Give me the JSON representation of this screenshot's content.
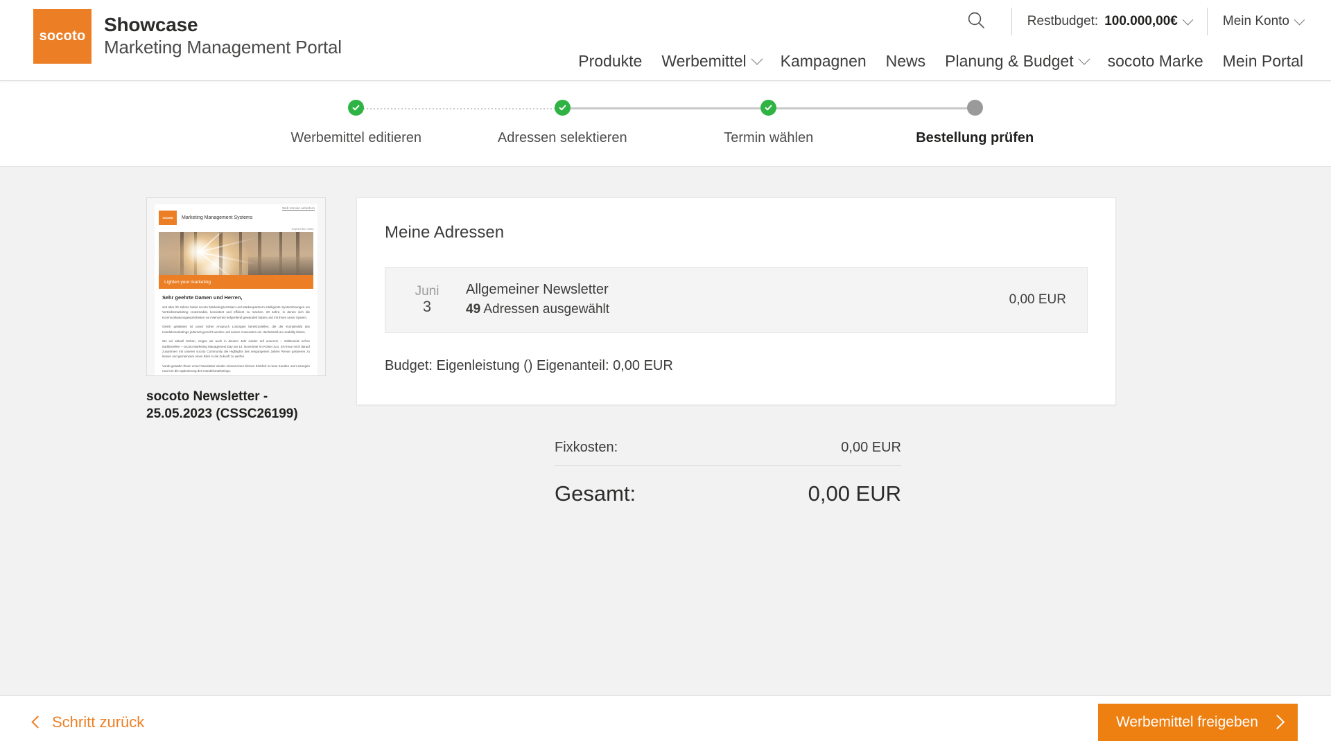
{
  "header": {
    "logo_text": "socoto",
    "title": "Showcase",
    "subtitle": "Marketing Management Portal",
    "search_icon": "search-icon",
    "budget_label": "Restbudget:",
    "budget_value": "100.000,00€",
    "account_label": "Mein Konto",
    "nav": [
      {
        "label": "Produkte",
        "caret": false
      },
      {
        "label": "Werbemittel",
        "caret": true
      },
      {
        "label": "Kampagnen",
        "caret": false
      },
      {
        "label": "News",
        "caret": false
      },
      {
        "label": "Planung & Budget",
        "caret": true
      },
      {
        "label": "socoto Marke",
        "caret": false
      },
      {
        "label": "Mein Portal",
        "caret": false
      }
    ]
  },
  "stepper": {
    "steps": [
      {
        "label": "Werbemittel editieren",
        "state": "done",
        "connector": "dotted"
      },
      {
        "label": "Adressen selektieren",
        "state": "done",
        "connector": "solid"
      },
      {
        "label": "Termin wählen",
        "state": "done",
        "connector": "solid"
      },
      {
        "label": "Bestellung prüfen",
        "state": "current",
        "connector": "none"
      }
    ]
  },
  "preview": {
    "caption": "socoto Newsletter - 25.05.2023 (CSSC26199)",
    "thumbnail": {
      "web_version_link": "Web Version anfordern",
      "logo_text": "socoto",
      "header_title": "Marketing Management Systems",
      "date": "September 2021",
      "hero_caption": "Lighten your marketing",
      "greeting": "Sehr geehrte Damen und Herren,",
      "paragraphs": [
        "seit über 20 Jahren bietet socoto Marketingzentralen und Markenpartnern intelligente Systemlösungen um Vertriebsmarketing crossmedial, konsistent und effizient zu machen. 20 Jahre, in denen sich die Kommunikationsgewohnheiten von Menschen tiefgreifend gewandelt haben und mit ihnen unser System.",
        "Gleich geblieben ist unser hoher Anspruch Lösungen bereitzustellen, die der Komplexität des Handelsmarketings jederzeit gerecht werden und seinen Anwendern ein Höchstmaß an Usability bieten.",
        "Wo wir aktuell stehen, zeigen wir auch in diesem Jahr wieder auf unserem – mittlerweile schon traditionellen – socoto Marketing Management Day am 14. November im Kölner Zoo. Ich freue mich darauf zusammen mit unserer socoto Community die Highlights des vergangenen Jahres Revue passieren zu lassen und gemeinsam einen Blick in die Zukunft zu werfen.",
        "Vorab gewährt Ihnen unser Newsletter wieder einmal einen kleinen Einblick in neue Kunden und Lösungen rund um die Optimierung des Handelsmarketings."
      ]
    }
  },
  "card": {
    "title": "Meine Adressen",
    "address_row": {
      "month": "Juni",
      "day": "3",
      "name": "Allgemeiner Newsletter",
      "count": "49",
      "count_suffix": "Adressen ausgewählt",
      "price": "0,00 EUR"
    },
    "budget_line": "Budget: Eigenleistung () Eigenanteil: 0,00 EUR"
  },
  "totals": {
    "fixed_label": "Fixkosten:",
    "fixed_value": "0,00 EUR",
    "grand_label": "Gesamt:",
    "grand_value": "0,00 EUR"
  },
  "footer": {
    "back_label": "Schritt zurück",
    "primary_label": "Werbemittel freigeben"
  },
  "colors": {
    "brand_orange": "#EC7F26",
    "button_orange": "#EE7F11",
    "step_done_green": "#2FB344",
    "step_pending_gray": "#9A9A9A",
    "content_bg": "#F2F2F2"
  }
}
